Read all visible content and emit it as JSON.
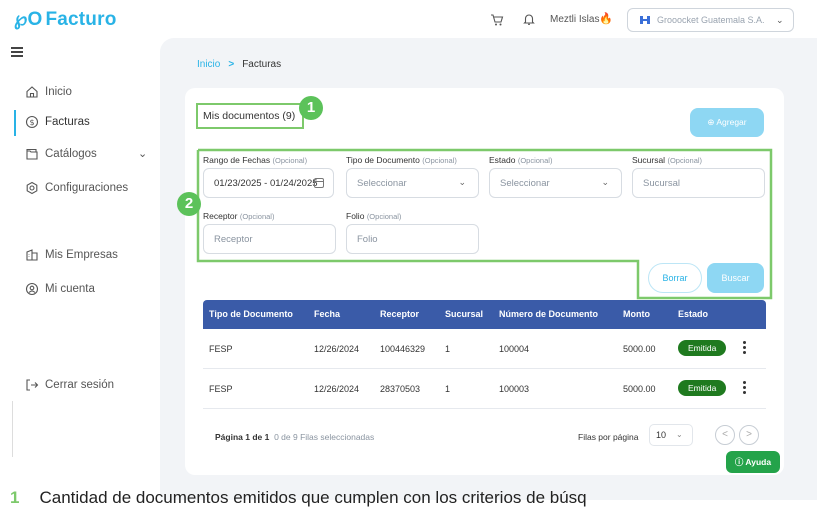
{
  "app": {
    "logo_text": "Facturo",
    "logo_mark": "℘O"
  },
  "header": {
    "cart_icon": "cart-icon",
    "bell_icon": "bell-icon",
    "user_name": "Meztli Islas",
    "avatar_glyph": "🔥",
    "company_name": "Grooocket Guatemala S.A.",
    "company_chevron": "⌄"
  },
  "sidebar": {
    "items": [
      {
        "label": "Inicio",
        "icon": "home-icon"
      },
      {
        "label": "Facturas",
        "icon": "dollar-circle-icon"
      },
      {
        "label": "Catálogos",
        "icon": "folder-icon"
      },
      {
        "label": "Configuraciones",
        "icon": "settings-icon"
      },
      {
        "label": "Mis Empresas",
        "icon": "building-icon"
      },
      {
        "label": "Mi cuenta",
        "icon": "user-circle-icon"
      },
      {
        "label": "Cerrar sesión",
        "icon": "logout-icon"
      }
    ],
    "chevron": "⌄"
  },
  "breadcrumb": {
    "home": "Inicio",
    "separator": ">",
    "current": "Facturas"
  },
  "card": {
    "title": "Mis documentos (9)",
    "add_label": "⊕ Agregar"
  },
  "filters": {
    "optional": "(Opcional)",
    "date_range": {
      "label": "Rango de Fechas",
      "value": "01/23/2025 - 01/24/2025"
    },
    "doc_type": {
      "label": "Tipo de Documento",
      "placeholder": "Seleccionar"
    },
    "status": {
      "label": "Estado",
      "placeholder": "Seleccionar"
    },
    "branch": {
      "label": "Sucursal",
      "placeholder": "Sucursal"
    },
    "receiver": {
      "label": "Receptor",
      "placeholder": "Receptor"
    },
    "folio": {
      "label": "Folio",
      "placeholder": "Folio"
    },
    "clear_label": "Borrar",
    "search_label": "Buscar"
  },
  "annotations": {
    "one": "1",
    "two": "2"
  },
  "table": {
    "headers": [
      "Tipo de Documento",
      "Fecha",
      "Receptor",
      "Sucursal",
      "Número de Documento",
      "Monto",
      "Estado"
    ],
    "rows": [
      {
        "type": "FESP",
        "date": "12/26/2024",
        "receiver": "100446329",
        "branch": "1",
        "number": "100004",
        "amount": "5000.00",
        "status": "Emitida"
      },
      {
        "type": "FESP",
        "date": "12/26/2024",
        "receiver": "28370503",
        "branch": "1",
        "number": "100003",
        "amount": "5000.00",
        "status": "Emitida"
      }
    ],
    "status_color": "#1f7a1f",
    "header_color": "#3a5ba8"
  },
  "pagination": {
    "page_text": "Página 1 de 1",
    "selected_text": "0 de 9 Filas seleccionadas",
    "rows_label": "Filas por página",
    "rows_value": "10",
    "prev": "<",
    "next": ">"
  },
  "help_label": "ⓘ Ayuda",
  "footnote": {
    "number": "1",
    "text": "Cantidad de documentos emitidos que cumplen con los criterios de búsq"
  },
  "colors": {
    "brand": "#29b3e6",
    "highlight": "#7dc96b",
    "button_light": "#8ed7f3"
  }
}
